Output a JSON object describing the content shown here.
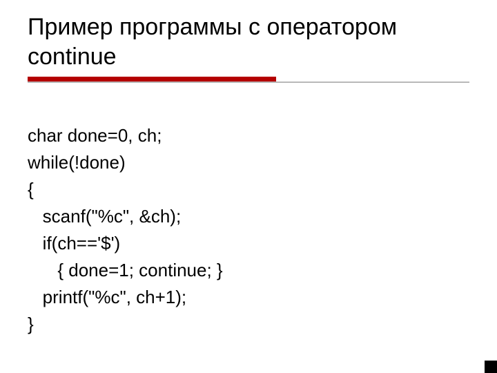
{
  "title_line1": "Пример программы с оператором",
  "title_line2": "continue",
  "code": {
    "l1": "char done=0, ch;",
    "l2": "while(!done)",
    "l3": "{",
    "l4": "   scanf(\"%c\", &ch);",
    "l5": "   if(ch=='$')",
    "l6": "      { done=1; continue; }",
    "l7": "   printf(\"%c\", ch+1);",
    "l8": "}"
  },
  "colors": {
    "accent": "#b40000",
    "rule_grey": "#b8b8b8"
  }
}
